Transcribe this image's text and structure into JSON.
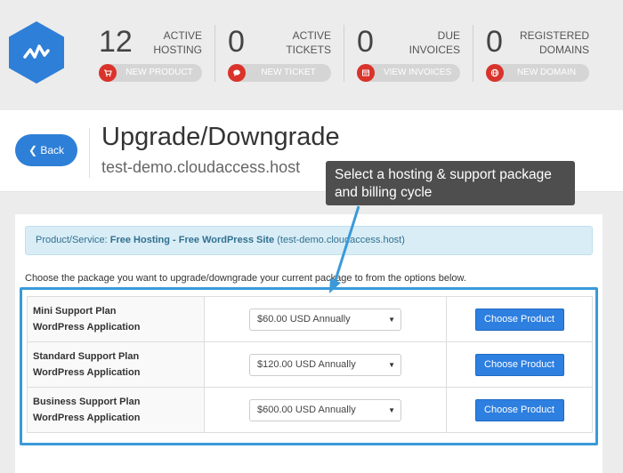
{
  "stats": [
    {
      "count": "12",
      "label_line1": "ACTIVE",
      "label_line2": "HOSTING",
      "button": "NEW PRODUCT",
      "icon": "cart-icon"
    },
    {
      "count": "0",
      "label_line1": "ACTIVE",
      "label_line2": "TICKETS",
      "button": "NEW TICKET",
      "icon": "comment-icon"
    },
    {
      "count": "0",
      "label_line1": "DUE",
      "label_line2": "INVOICES",
      "button": "VIEW INVOICES",
      "icon": "invoice-icon"
    },
    {
      "count": "0",
      "label_line1": "REGISTERED",
      "label_line2": "DOMAINS",
      "button": "NEW DOMAIN",
      "icon": "globe-icon"
    }
  ],
  "header": {
    "back_label": "Back",
    "title": "Upgrade/Downgrade",
    "subtitle": "test-demo.cloudaccess.host"
  },
  "tooltip": {
    "line1": "Select a hosting & support package",
    "line2": "and billing cycle"
  },
  "alert": {
    "prefix": "Product/Service: ",
    "product": "Free Hosting - Free WordPress Site",
    "domain": " (test-demo.cloudaccess.host)"
  },
  "instruction": "Choose the package you want to upgrade/downgrade your current package to from the options below.",
  "packages": [
    {
      "name_line1": "Mini Support Plan",
      "name_line2": "WordPress Application",
      "price": "$60.00 USD Annually",
      "button": "Choose Product"
    },
    {
      "name_line1": "Standard Support Plan",
      "name_line2": "WordPress Application",
      "price": "$120.00 USD Annually",
      "button": "Choose Product"
    },
    {
      "name_line1": "Business Support Plan",
      "name_line2": "WordPress Application",
      "price": "$600.00 USD Annually",
      "button": "Choose Product"
    }
  ],
  "colors": {
    "accent": "#2e7fd7",
    "pill_icon": "#d9332b",
    "alert_bg": "#d9edf7",
    "highlight": "#3a9ad9"
  }
}
